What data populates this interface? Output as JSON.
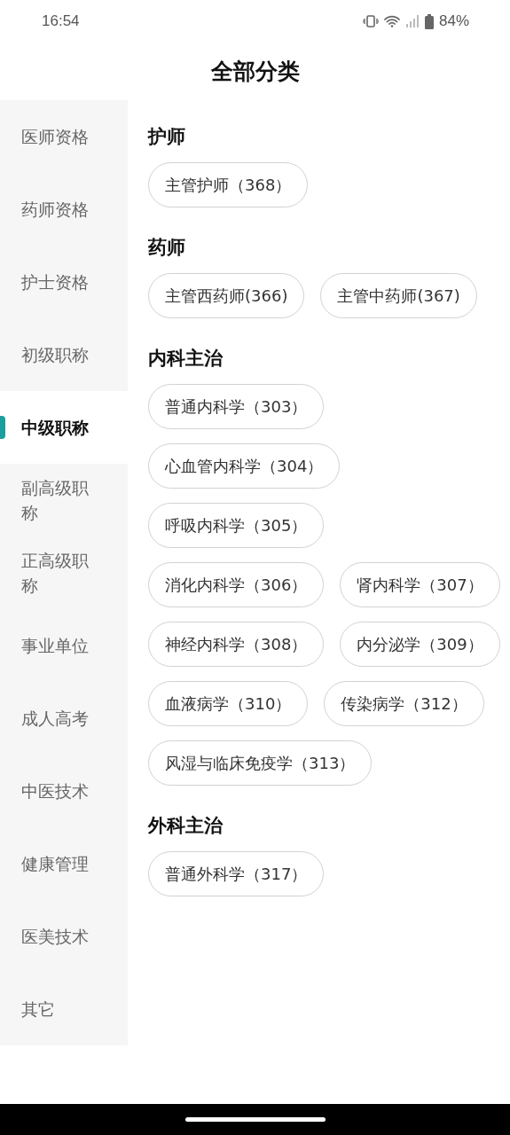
{
  "status_bar": {
    "time": "16:54",
    "battery": "84%"
  },
  "title": "全部分类",
  "sidebar": {
    "items": [
      {
        "label": "医师资格",
        "selected": false
      },
      {
        "label": "药师资格",
        "selected": false
      },
      {
        "label": "护士资格",
        "selected": false
      },
      {
        "label": "初级职称",
        "selected": false
      },
      {
        "label": "中级职称",
        "selected": true
      },
      {
        "label": "副高级职称",
        "selected": false
      },
      {
        "label": "正高级职称",
        "selected": false
      },
      {
        "label": "事业单位",
        "selected": false
      },
      {
        "label": "成人高考",
        "selected": false
      },
      {
        "label": "中医技术",
        "selected": false
      },
      {
        "label": "健康管理",
        "selected": false
      },
      {
        "label": "医美技术",
        "selected": false
      },
      {
        "label": "其它",
        "selected": false
      }
    ]
  },
  "sections": [
    {
      "title": "护师",
      "chips": [
        "主管护师（368）"
      ]
    },
    {
      "title": "药师",
      "chips": [
        "主管西药师(366)",
        "主管中药师(367)"
      ]
    },
    {
      "title": "内科主治",
      "chips": [
        "普通内科学（303）",
        "心血管内科学（304）",
        "呼吸内科学（305）",
        "消化内科学（306）",
        "肾内科学（307）",
        "神经内科学（308）",
        "内分泌学（309）",
        "血液病学（310）",
        "传染病学（312）",
        "风湿与临床免疫学（313）"
      ]
    },
    {
      "title": "外科主治",
      "chips": [
        "普通外科学（317）"
      ]
    }
  ]
}
